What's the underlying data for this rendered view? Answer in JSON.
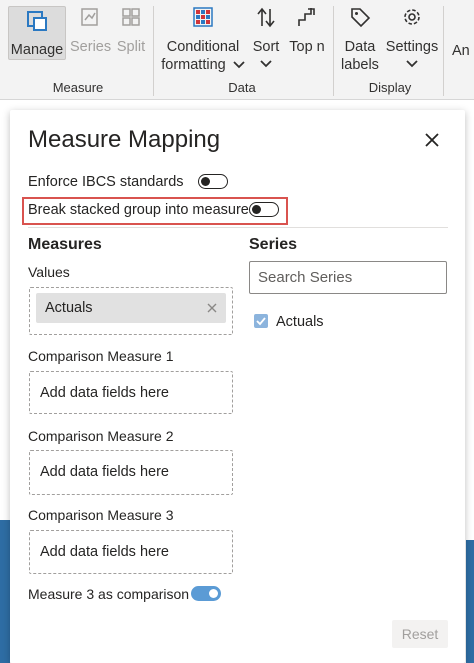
{
  "ribbon": {
    "manage": "Manage",
    "series": "Series",
    "split": "Split",
    "conditional_line1": "Conditional",
    "conditional_line2": "formatting",
    "sort": "Sort",
    "topn": "Top n",
    "data_labels_line1": "Data",
    "data_labels_line2": "labels",
    "settings": "Settings",
    "partial": "An",
    "groups": {
      "measure": "Measure",
      "data": "Data",
      "display": "Display"
    }
  },
  "dialog": {
    "title": "Measure Mapping",
    "enforce_ibcs": "Enforce IBCS standards",
    "break_stacked": "Break stacked group into measures",
    "measures_header": "Measures",
    "series_header": "Series",
    "values_label": "Values",
    "values_item": "Actuals",
    "comparison1_label": "Comparison Measure 1",
    "comparison2_label": "Comparison Measure 2",
    "comparison3_label": "Comparison Measure 3",
    "add_fields": "Add data fields here",
    "search_placeholder": "Search Series",
    "series_item": "Actuals",
    "measure3_label": "Measure 3 as comparison",
    "reset": "Reset"
  },
  "state": {
    "enforce_ibcs_on": false,
    "break_stacked_on": false,
    "measure3_on": true,
    "series_actuals_checked": true
  },
  "colors": {
    "accent": "#5b9bd5",
    "highlight_border": "#d9534f",
    "background_blue": "#2e6da4"
  },
  "icons": [
    "manage-icon",
    "series-icon",
    "split-icon",
    "conditional-formatting-icon",
    "sort-icon",
    "top-n-icon",
    "data-labels-icon",
    "settings-icon",
    "close-icon",
    "remove-icon",
    "checkmark-icon",
    "chevron-down-icon"
  ]
}
